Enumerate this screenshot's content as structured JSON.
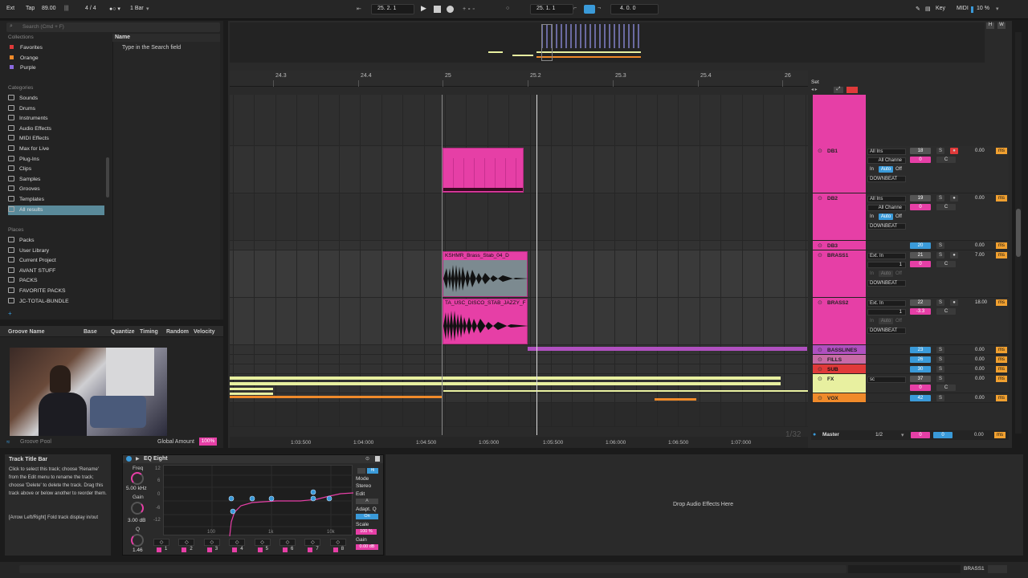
{
  "transport": {
    "ext": "Ext",
    "tap": "Tap",
    "tempo": "89.00",
    "signature": "4 / 4",
    "quantize": "1 Bar",
    "position": "25.  2.  1",
    "loop_start": "25.  1.  1",
    "loop_length": "4.  0.  0",
    "key": "Key",
    "midi": "MIDI",
    "cpu": "10 %"
  },
  "browser": {
    "search_placeholder": "Search (Cmd + F)",
    "collections_label": "Collections",
    "collections": [
      {
        "label": "Favorites",
        "color": "#e03a3a"
      },
      {
        "label": "Orange",
        "color": "#f08a2a"
      },
      {
        "label": "Purple",
        "color": "#8a6adf"
      }
    ],
    "categories_label": "Categories",
    "categories": [
      "Sounds",
      "Drums",
      "Instruments",
      "Audio Effects",
      "MIDI Effects",
      "Max for Live",
      "Plug-Ins",
      "Clips",
      "Samples",
      "Grooves",
      "Templates",
      "All results"
    ],
    "places_label": "Places",
    "places": [
      "Packs",
      "User Library",
      "Current Project",
      "AVANT STUFF",
      "PACKS",
      "FAVORITE PACKS",
      "JC-TOTAL-BUNDLE"
    ],
    "name_header": "Name",
    "empty_hint": "Type in the Search field"
  },
  "groove": {
    "headers": [
      "Groove Name",
      "Base",
      "Quantize",
      "Timing",
      "Random",
      "Velocity"
    ],
    "pool_label": "Groove Pool",
    "global_amount_label": "Global Amount",
    "global_amount_value": "100%"
  },
  "ruler": {
    "bars": [
      "24.3",
      "24.4",
      "25",
      "25.2",
      "25.3",
      "25.4",
      "26"
    ],
    "times": [
      "1:03:500",
      "1:04:000",
      "1:04:500",
      "1:05:000",
      "1:05:500",
      "1:06:000",
      "1:06:500",
      "1:07:000"
    ],
    "set_label": "Set",
    "zoom_label": "1/32"
  },
  "clips": {
    "brass1": "KSHMR_Brass_Stab_04_D",
    "brass2": "TA_USC_DISCO_STAB_JAZZY_F"
  },
  "tracks": [
    {
      "name": "DB1",
      "input": "All Ins",
      "channel": "All Channe",
      "out": "DOWNBEAT",
      "num": "18",
      "vol": "0",
      "pan": "C",
      "send": "0.00"
    },
    {
      "name": "DB2",
      "input": "All Ins",
      "channel": "All Channe",
      "out": "DOWNBEAT",
      "num": "19",
      "vol": "0",
      "pan": "C",
      "send": "0.00"
    },
    {
      "name": "DB3",
      "num": "20",
      "send": "0.00"
    },
    {
      "name": "BRASS1",
      "input": "Ext. In",
      "channel": "1",
      "out": "DOWNBEAT",
      "num": "21",
      "vol": "0",
      "pan": "C",
      "send": "7.00"
    },
    {
      "name": "BRASS2",
      "input": "Ext. In",
      "channel": "1",
      "out": "DOWNBEAT",
      "num": "22",
      "vol": "-3.3",
      "pan": "C",
      "send": "18.00"
    },
    {
      "name": "BASSLINES",
      "num": "23",
      "send": "0.00"
    },
    {
      "name": "FILLS",
      "num": "26",
      "send": "0.00"
    },
    {
      "name": "SUB",
      "num": "30",
      "send": "0.00"
    },
    {
      "name": "FX",
      "input": "sc",
      "num": "37",
      "vol": "0",
      "pan": "C",
      "send": "0.00"
    },
    {
      "name": "VOX",
      "num": "42",
      "send": "0.00"
    }
  ],
  "monitor": {
    "in": "In",
    "auto": "Auto",
    "off": "Off"
  },
  "master": {
    "name": "Master",
    "io": "1/2",
    "vol": "0",
    "pan": "0",
    "send": "0.00"
  },
  "ms_unit": "ms",
  "info": {
    "title": "Track Title Bar",
    "body": "Click to select this track; choose 'Rename' from the Edit menu to rename the track; choose 'Delete' to delete the track. Drag this track above or below another to reorder them.",
    "body2": "[Arrow Left/Right] Fold track display in/out"
  },
  "eq": {
    "title": "EQ Eight",
    "freq_label": "Freq",
    "freq_value": "5.00 kHz",
    "gain_label": "Gain",
    "gain_value": "3.00 dB",
    "q_label": "Q",
    "q_value": "1.46",
    "db_ticks": [
      "12",
      "6",
      "0",
      "-6",
      "-12"
    ],
    "freq_ticks": [
      "100",
      "1k",
      "10k"
    ],
    "mode_label": "Mode",
    "mode_value": "Stereo",
    "edit_label": "Edit",
    "edit_value": "A",
    "adapt_label": "Adapt. Q",
    "adapt_value": "On",
    "scale_label": "Scale",
    "scale_value": "100 %",
    "out_gain_label": "Gain",
    "out_gain_value": "0.00 dB",
    "bands": [
      "1",
      "2",
      "3",
      "4",
      "5",
      "6",
      "7",
      "8"
    ]
  },
  "drop_hint": "Drop Audio Effects Here",
  "status": {
    "track": "BRASS1"
  }
}
